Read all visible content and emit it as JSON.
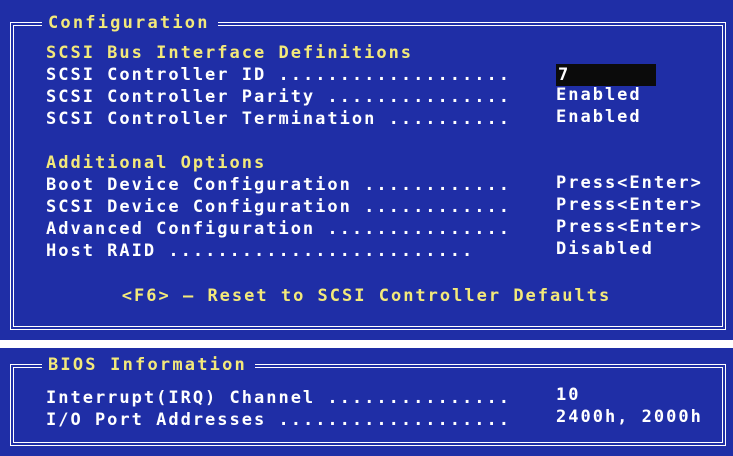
{
  "configuration": {
    "title": "Configuration",
    "bus_section": {
      "heading": "SCSI Bus Interface Definitions",
      "items": [
        {
          "label": "SCSI Controller ID",
          "value": "7"
        },
        {
          "label": "SCSI Controller Parity",
          "value": "Enabled"
        },
        {
          "label": "SCSI Controller Termination",
          "value": "Enabled"
        }
      ]
    },
    "options_section": {
      "heading": "Additional Options",
      "items": [
        {
          "label": "Boot Device Configuration",
          "value": "Press<Enter>"
        },
        {
          "label": "SCSI Device Configuration",
          "value": "Press<Enter>"
        },
        {
          "label": "Advanced Configuration",
          "value": "Press<Enter>"
        },
        {
          "label": "Host RAID",
          "value": "Disabled"
        }
      ]
    },
    "reset_hint": "<F6> – Reset to SCSI Controller Defaults"
  },
  "bios": {
    "title": "BIOS Information",
    "items": [
      {
        "label": "Interrupt(IRQ) Channel",
        "value": "10"
      },
      {
        "label": "I/O Port Addresses",
        "value": "2400h, 2000h"
      }
    ]
  },
  "colors": {
    "background": "#1f2ea6",
    "heading": "#f3e97a",
    "text": "#ffffff",
    "selection": "#0b0b0b"
  }
}
